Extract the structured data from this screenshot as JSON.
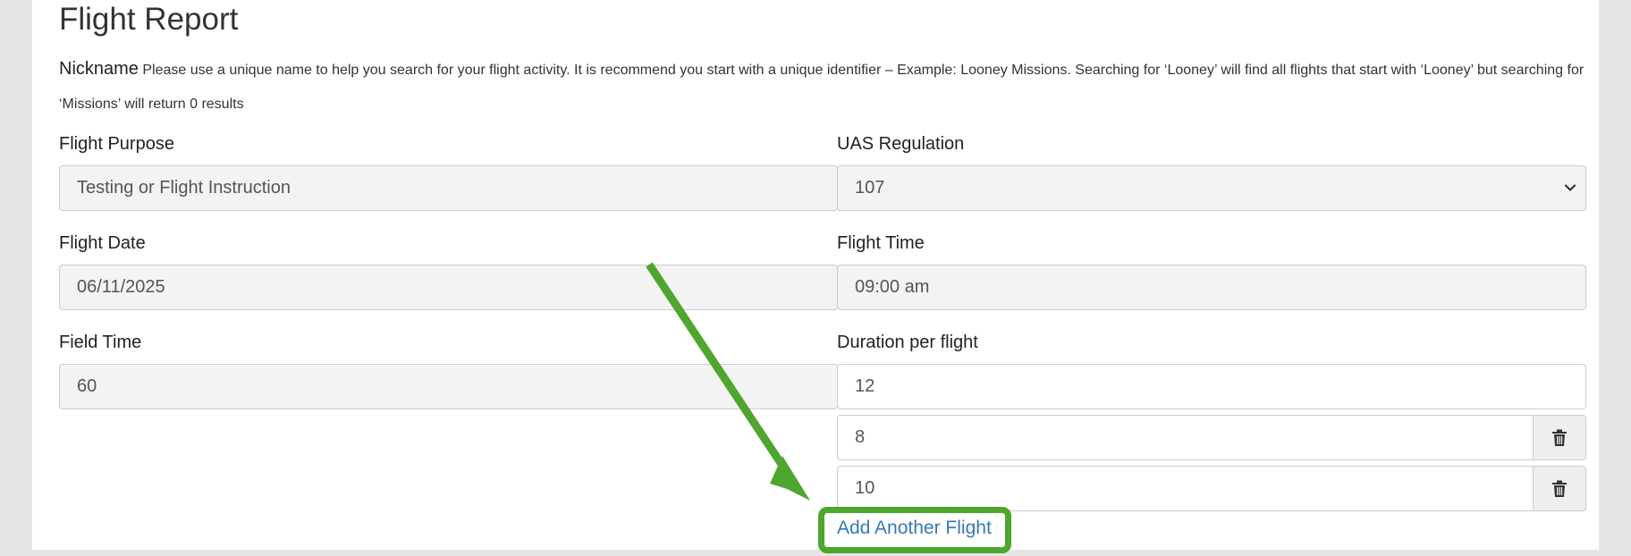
{
  "form": {
    "title": "Flight Report",
    "nickname": {
      "label": "Nickname",
      "help": "Please use a unique name to help you search for your flight activity. It is recommend you start with a unique identifier – Example: Looney Missions. Searching for ‘Looney’ will find all flights that start with ‘Looney’ but searching for ‘Missions’ will return 0 results"
    },
    "flight_purpose": {
      "label": "Flight Purpose",
      "value": "Testing or Flight Instruction"
    },
    "uas_regulation": {
      "label": "UAS Regulation",
      "value": "107"
    },
    "flight_date": {
      "label": "Flight Date",
      "value": "06/11/2025"
    },
    "flight_time": {
      "label": "Flight Time",
      "value": "09:00 am"
    },
    "field_time": {
      "label": "Field Time",
      "value": "60"
    },
    "duration": {
      "label": "Duration per flight",
      "values": [
        "12",
        "8",
        "10"
      ]
    },
    "add_flight_label": "Add Another Flight"
  },
  "icons": {
    "select_arrow": "chevron-down-icon",
    "delete": "trash-icon"
  },
  "colors": {
    "highlight": "#4ea62f",
    "link": "#337ab7"
  }
}
